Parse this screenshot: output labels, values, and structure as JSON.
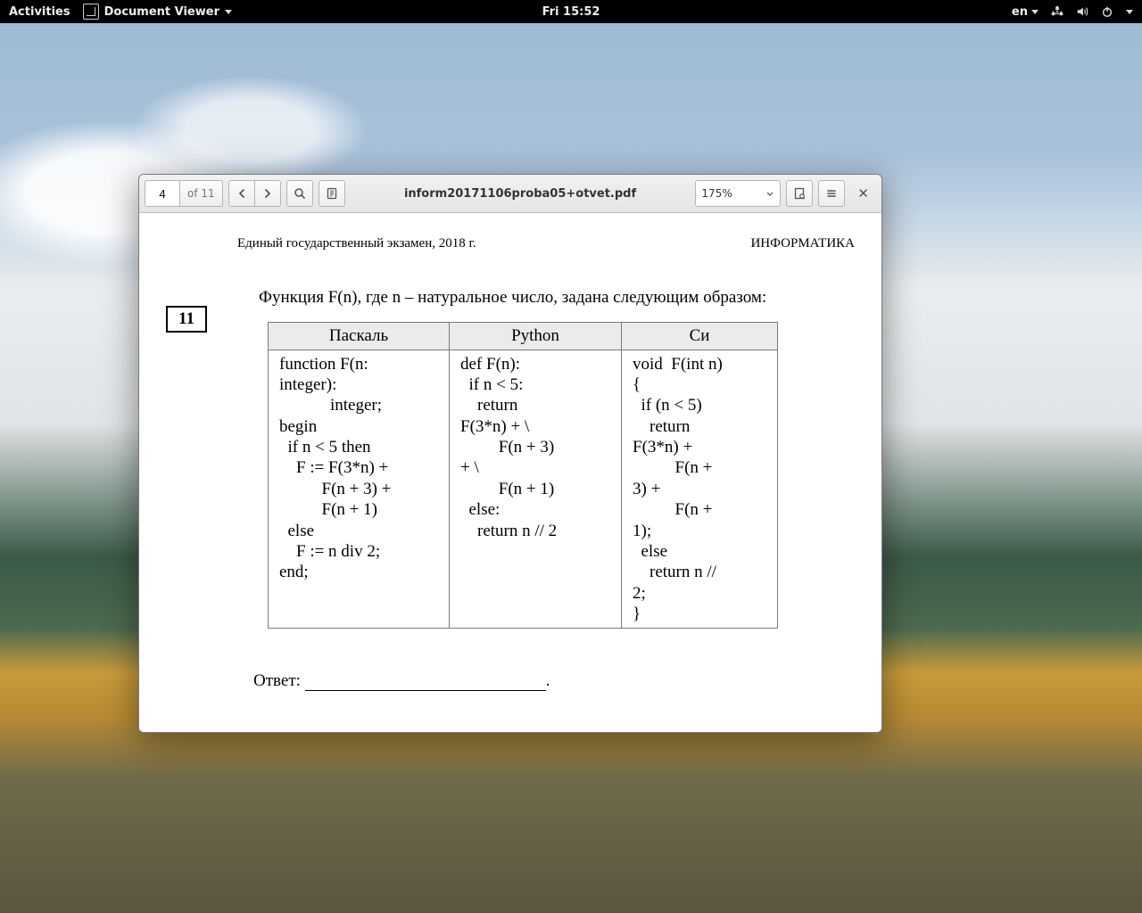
{
  "topbar": {
    "activities": "Activities",
    "app_name": "Document Viewer",
    "clock": "Fri 15:52",
    "lang": "en"
  },
  "window": {
    "page_current": "4",
    "page_of": "of 11",
    "title": "inform20171106proba05+otvet.pdf",
    "zoom": "175%"
  },
  "document": {
    "header_left": "Единый государственный экзамен, 2018 г.",
    "header_right": "ИНФОРМАТИКА",
    "question_number": "11",
    "question_text": "Функция F(n), где n – натуральное число, задана следующим образом:",
    "table": {
      "headers": [
        "Паскаль",
        "Python",
        "Си"
      ],
      "pascal": "function F(n:\ninteger):\n            integer;\nbegin\n  if n < 5 then\n    F := F(3*n) +\n          F(n + 3) +\n          F(n + 1)\n  else\n    F := n div 2;\nend;",
      "python": "def F(n):\n  if n < 5:\n    return\nF(3*n) + \\\n         F(n + 3)\n+ \\\n         F(n + 1)\n  else:\n    return n // 2",
      "c": "void  F(int n)\n{\n  if (n < 5)\n    return\nF(3*n) +\n          F(n +\n3) +\n          F(n +\n1);\n  else\n    return n //\n2;\n}"
    },
    "answer_label": "Ответ: ",
    "answer_trail": "."
  }
}
